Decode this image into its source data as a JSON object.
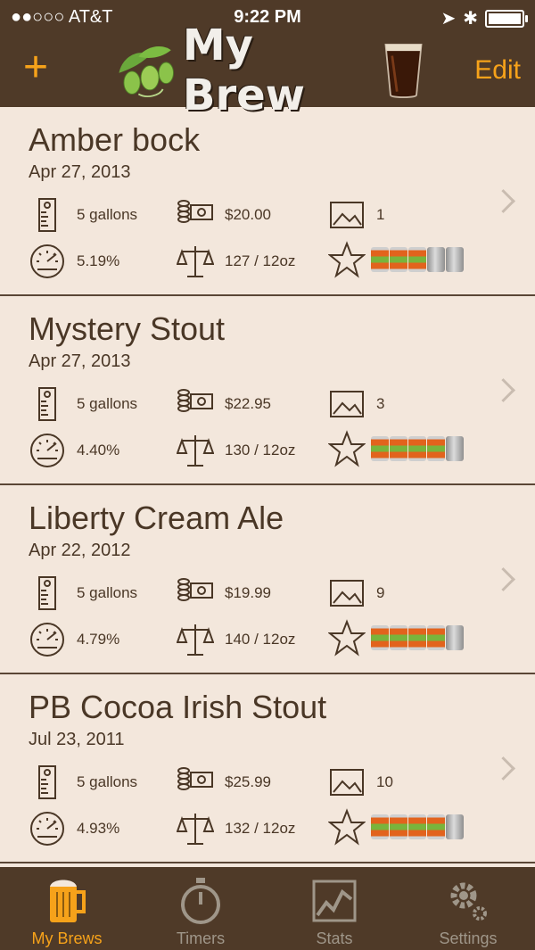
{
  "status_bar": {
    "carrier": "●●○○○ AT&T",
    "time": "9:22 PM"
  },
  "nav": {
    "add_label": "+",
    "edit_label": "Edit",
    "title": "My Brew"
  },
  "colors": {
    "accent": "#f6a21a",
    "bar_bg": "#4f3a28",
    "content_bg": "#f3e7dc",
    "text": "#4a3726"
  },
  "brews": [
    {
      "name": "Amber bock",
      "date": "Apr 27, 2013",
      "volume": "5 gallons",
      "cost": "$20.00",
      "photos": "1",
      "abv": "5.19%",
      "yield": "127 / 12oz",
      "rating": 3
    },
    {
      "name": "Mystery Stout",
      "date": "Apr 27, 2013",
      "volume": "5 gallons",
      "cost": "$22.95",
      "photos": "3",
      "abv": "4.40%",
      "yield": "130 / 12oz",
      "rating": 4
    },
    {
      "name": "Liberty Cream Ale",
      "date": "Apr 22, 2012",
      "volume": "5 gallons",
      "cost": "$19.99",
      "photos": "9",
      "abv": "4.79%",
      "yield": "140 / 12oz",
      "rating": 4
    },
    {
      "name": "PB Cocoa Irish Stout",
      "date": "Jul 23, 2011",
      "volume": "5 gallons",
      "cost": "$25.99",
      "photos": "10",
      "abv": "4.93%",
      "yield": "132 / 12oz",
      "rating": 4
    }
  ],
  "rating_max": 5,
  "tabs": [
    {
      "label": "My Brews",
      "icon": "beer-mug-icon",
      "active": true
    },
    {
      "label": "Timers",
      "icon": "stopwatch-icon",
      "active": false
    },
    {
      "label": "Stats",
      "icon": "chart-icon",
      "active": false
    },
    {
      "label": "Settings",
      "icon": "gear-icon",
      "active": false
    }
  ]
}
